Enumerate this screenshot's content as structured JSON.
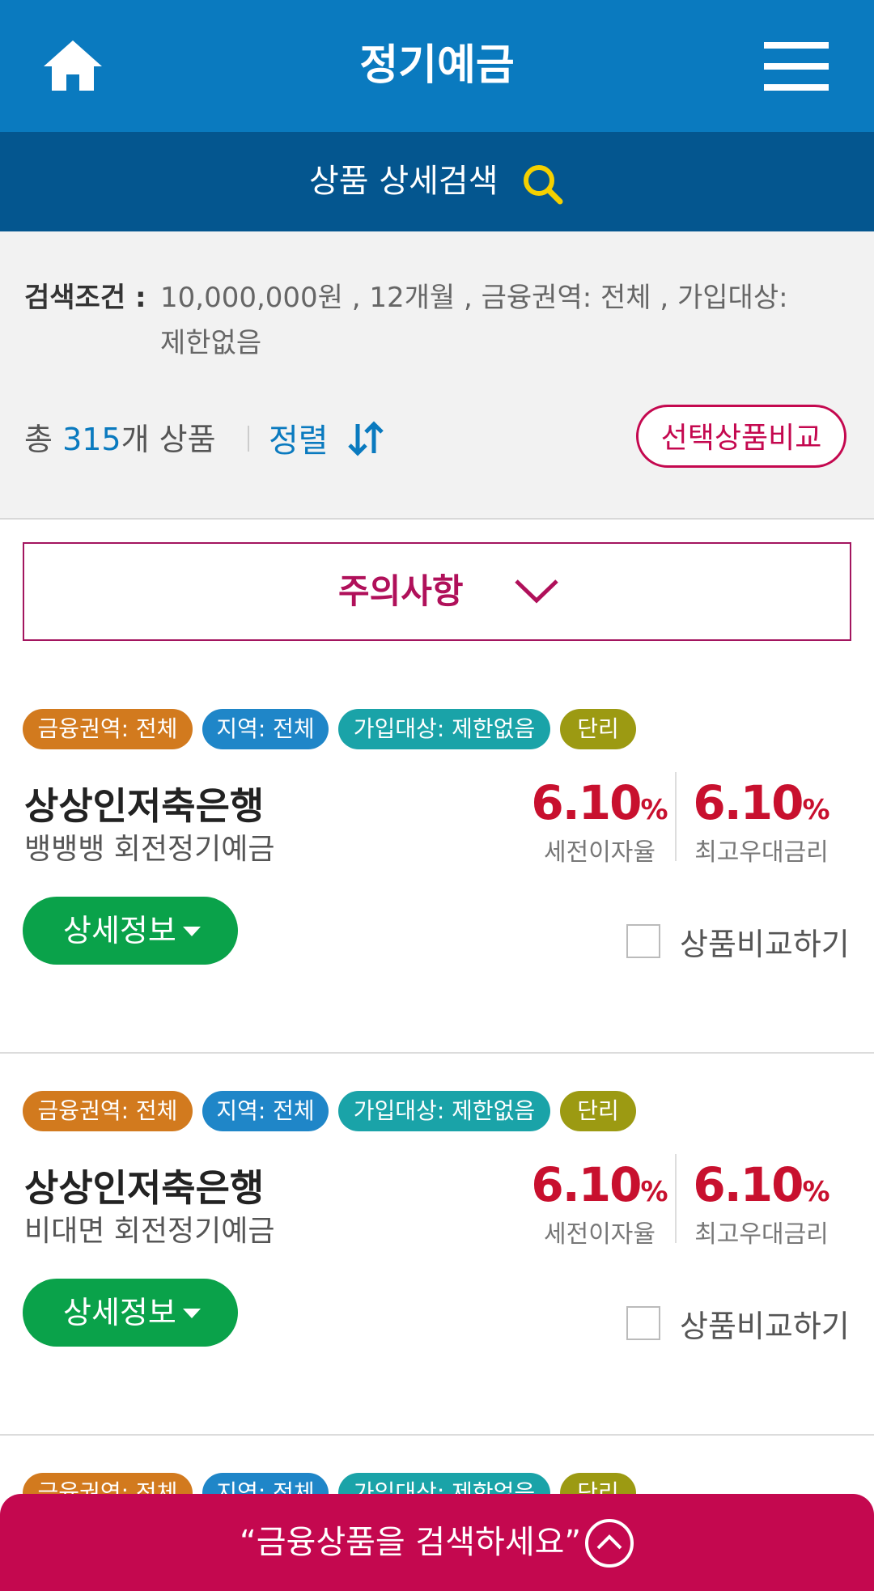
{
  "header": {
    "title": "정기예금",
    "home_icon": "home-icon",
    "menu_icon": "hamburger-menu-icon"
  },
  "search_bar": {
    "label": "상품 상세검색",
    "icon": "search-icon",
    "icon_color": "#f5d000"
  },
  "conditions": {
    "label": "검색조건 :",
    "text": "10,000,000원 , 12개월 , 금융권역: 전체 , 가입대상: 제한없음"
  },
  "summary": {
    "prefix": "총",
    "count": "315",
    "suffix": "개 상품",
    "sort_label": "정렬",
    "compare_button": "선택상품비교"
  },
  "notice": {
    "label": "주의사항"
  },
  "tag_colors": {
    "sector": "#d27a1e",
    "region": "#1f86c8",
    "target": "#1aa3a8",
    "interest": "#9c9a12"
  },
  "products": [
    {
      "tags": [
        "금융권역: 전체",
        "지역: 전체",
        "가입대상: 제한없음",
        "단리"
      ],
      "bank": "상상인저축은행",
      "name": "뱅뱅뱅 회전정기예금",
      "rate_pre_tax": "6.10",
      "rate_pre_tax_label": "세전이자율",
      "rate_max": "6.10",
      "rate_max_label": "최고우대금리",
      "percent": "%",
      "detail_button": "상세정보",
      "compare_label": "상품비교하기"
    },
    {
      "tags": [
        "금융권역: 전체",
        "지역: 전체",
        "가입대상: 제한없음",
        "단리"
      ],
      "bank": "상상인저축은행",
      "name": "비대면 회전정기예금",
      "rate_pre_tax": "6.10",
      "rate_pre_tax_label": "세전이자율",
      "rate_max": "6.10",
      "rate_max_label": "최고우대금리",
      "percent": "%",
      "detail_button": "상세정보",
      "compare_label": "상품비교하기"
    },
    {
      "tags": [
        "금융권역: 전체",
        "지역: 전체",
        "가입대상: 제한없음",
        "단리"
      ]
    }
  ],
  "bottom_bar": {
    "label": "“금융상품을 검색하세요”",
    "icon": "chevron-up-circle-icon"
  }
}
